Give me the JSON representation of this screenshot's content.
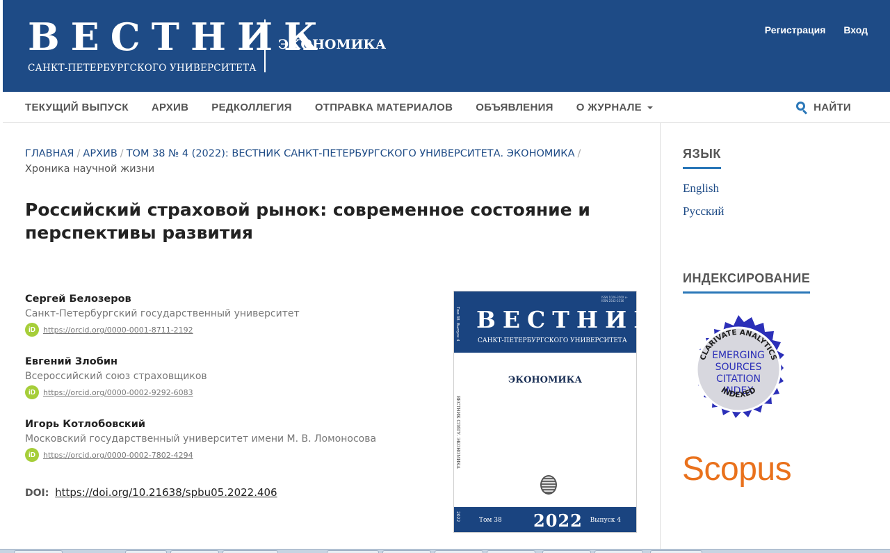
{
  "header": {
    "logo_word": "ВЕСТНИК",
    "logo_sub": "САНКТ-ПЕТЕРБУРГСКОГО УНИВЕРСИТЕТА",
    "section": "ЭКОНОМИКА",
    "register": "Регистрация",
    "login": "Вход"
  },
  "nav": {
    "items": [
      "ТЕКУЩИЙ ВЫПУСК",
      "АРХИВ",
      "РЕДКОЛЛЕГИЯ",
      "ОТПРАВКА МАТЕРИАЛОВ",
      "ОБЪЯВЛЕНИЯ",
      "О ЖУРНАЛЕ"
    ],
    "search": "НАЙТИ"
  },
  "breadcrumb": {
    "home": "ГЛАВНАЯ",
    "archive": "АРХИВ",
    "issue": "ТОМ 38 № 4 (2022): ВЕСТНИК САНКТ-ПЕТЕРБУРГСКОГО УНИВЕРСИТЕТА. ЭКОНОМИКА",
    "current": "Хроника научной жизни"
  },
  "article": {
    "title": "Российский страховой рынок: современное состояние и перспективы развития",
    "authors": [
      {
        "name": "Сергей Белозеров",
        "affiliation": "Санкт-Петербургский государственный университет",
        "orcid": "https://orcid.org/0000-0001-8711-2192"
      },
      {
        "name": "Евгений Злобин",
        "affiliation": "Всероссийский союз страховщиков",
        "orcid": "https://orcid.org/0000-0002-9292-6083"
      },
      {
        "name": "Игорь Котлобовский",
        "affiliation": "Московский государственный университет имени М. В. Ломоносова",
        "orcid": "https://orcid.org/0000-0002-7802-4294"
      }
    ],
    "orcid_badge": "iD",
    "doi_label": "DOI:",
    "doi": "https://doi.org/10.21638/spbu05.2022.406"
  },
  "cover": {
    "word": "ВЕСТНИК",
    "sub": "САНКТ-ПЕТЕРБУРГСКОГО УНИВЕРСИТЕТА",
    "issn": "ISSN 1026-356X e-ISSN 2542-2316",
    "spine_top": "Том 38. Выпуск 4",
    "section": "ЭКОНОМИКА",
    "spine": "ВЕСТНИК СПбГУ. ЭКОНОМИКА",
    "tom": "Том 38",
    "year": "2022",
    "vyp": "Выпуск 4",
    "spine_bottom": "2022"
  },
  "sidebar": {
    "language_title": "ЯЗЫК",
    "languages": [
      "English",
      "Русский"
    ],
    "indexing_title": "ИНДЕКСИРОВАНИЕ",
    "esci_ring": "CLARIVATE ANALYTICS",
    "esci_lines": [
      "EMERGING",
      "SOURCES",
      "CITATION",
      "INDEX"
    ],
    "esci_bottom": "INDEXED",
    "scopus": "Scopus"
  },
  "colors": {
    "header_bg": "#1e4b86",
    "link": "#1e4b86",
    "accent": "#2a77b8",
    "orcid": "#a6ce39",
    "scopus": "#e9711c"
  }
}
